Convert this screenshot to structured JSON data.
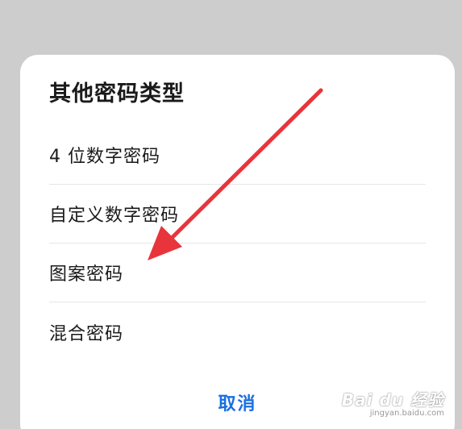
{
  "dialog": {
    "title": "其他密码类型",
    "options": [
      {
        "label": "4 位数字密码"
      },
      {
        "label": "自定义数字密码"
      },
      {
        "label": "图案密码"
      },
      {
        "label": "混合密码"
      }
    ],
    "cancel_label": "取消"
  },
  "annotation": {
    "arrow_color": "#e8343b"
  },
  "watermark": {
    "logo_text": "Bai du 经验",
    "url": "jingyan.baidu.com"
  },
  "colors": {
    "backdrop": "#cdcdcd",
    "dialog_bg": "#ffffff",
    "accent": "#1a6fe0",
    "text": "#1a1a1a",
    "divider": "#e6e6e6"
  }
}
